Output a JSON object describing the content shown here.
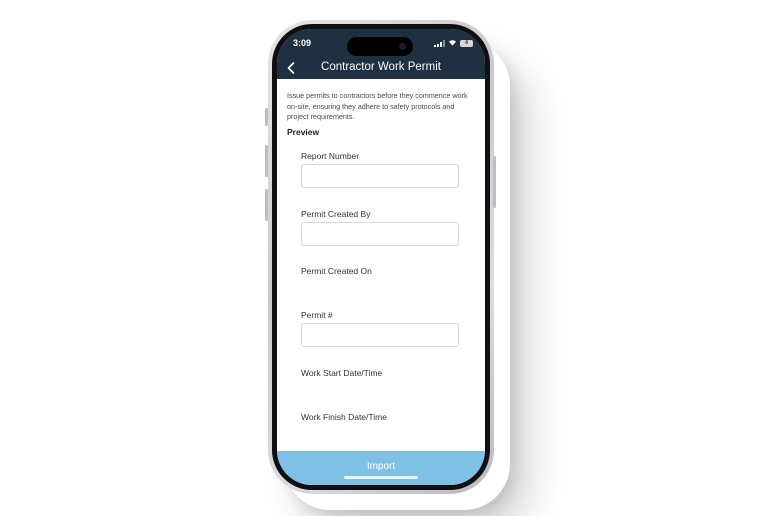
{
  "status_bar": {
    "time": "3:09",
    "battery": "4"
  },
  "header": {
    "title": "Contractor Work Permit"
  },
  "form": {
    "description": "Issue permits to contractors before they commence work on-site, ensuring they adhere to safety protocols and project requirements.",
    "preview_label": "Preview",
    "fields": [
      {
        "label": "Report Number",
        "value": ""
      },
      {
        "label": "Permit Created By",
        "value": ""
      },
      {
        "label": "Permit Created On"
      },
      {
        "label": "Permit #",
        "value": ""
      },
      {
        "label": "Work Start Date/Time"
      },
      {
        "label": "Work Finish Date/Time"
      }
    ]
  },
  "footer": {
    "import_label": "Import"
  },
  "colors": {
    "header_bg": "#1f3041",
    "import_bg": "#7fc0e4"
  }
}
